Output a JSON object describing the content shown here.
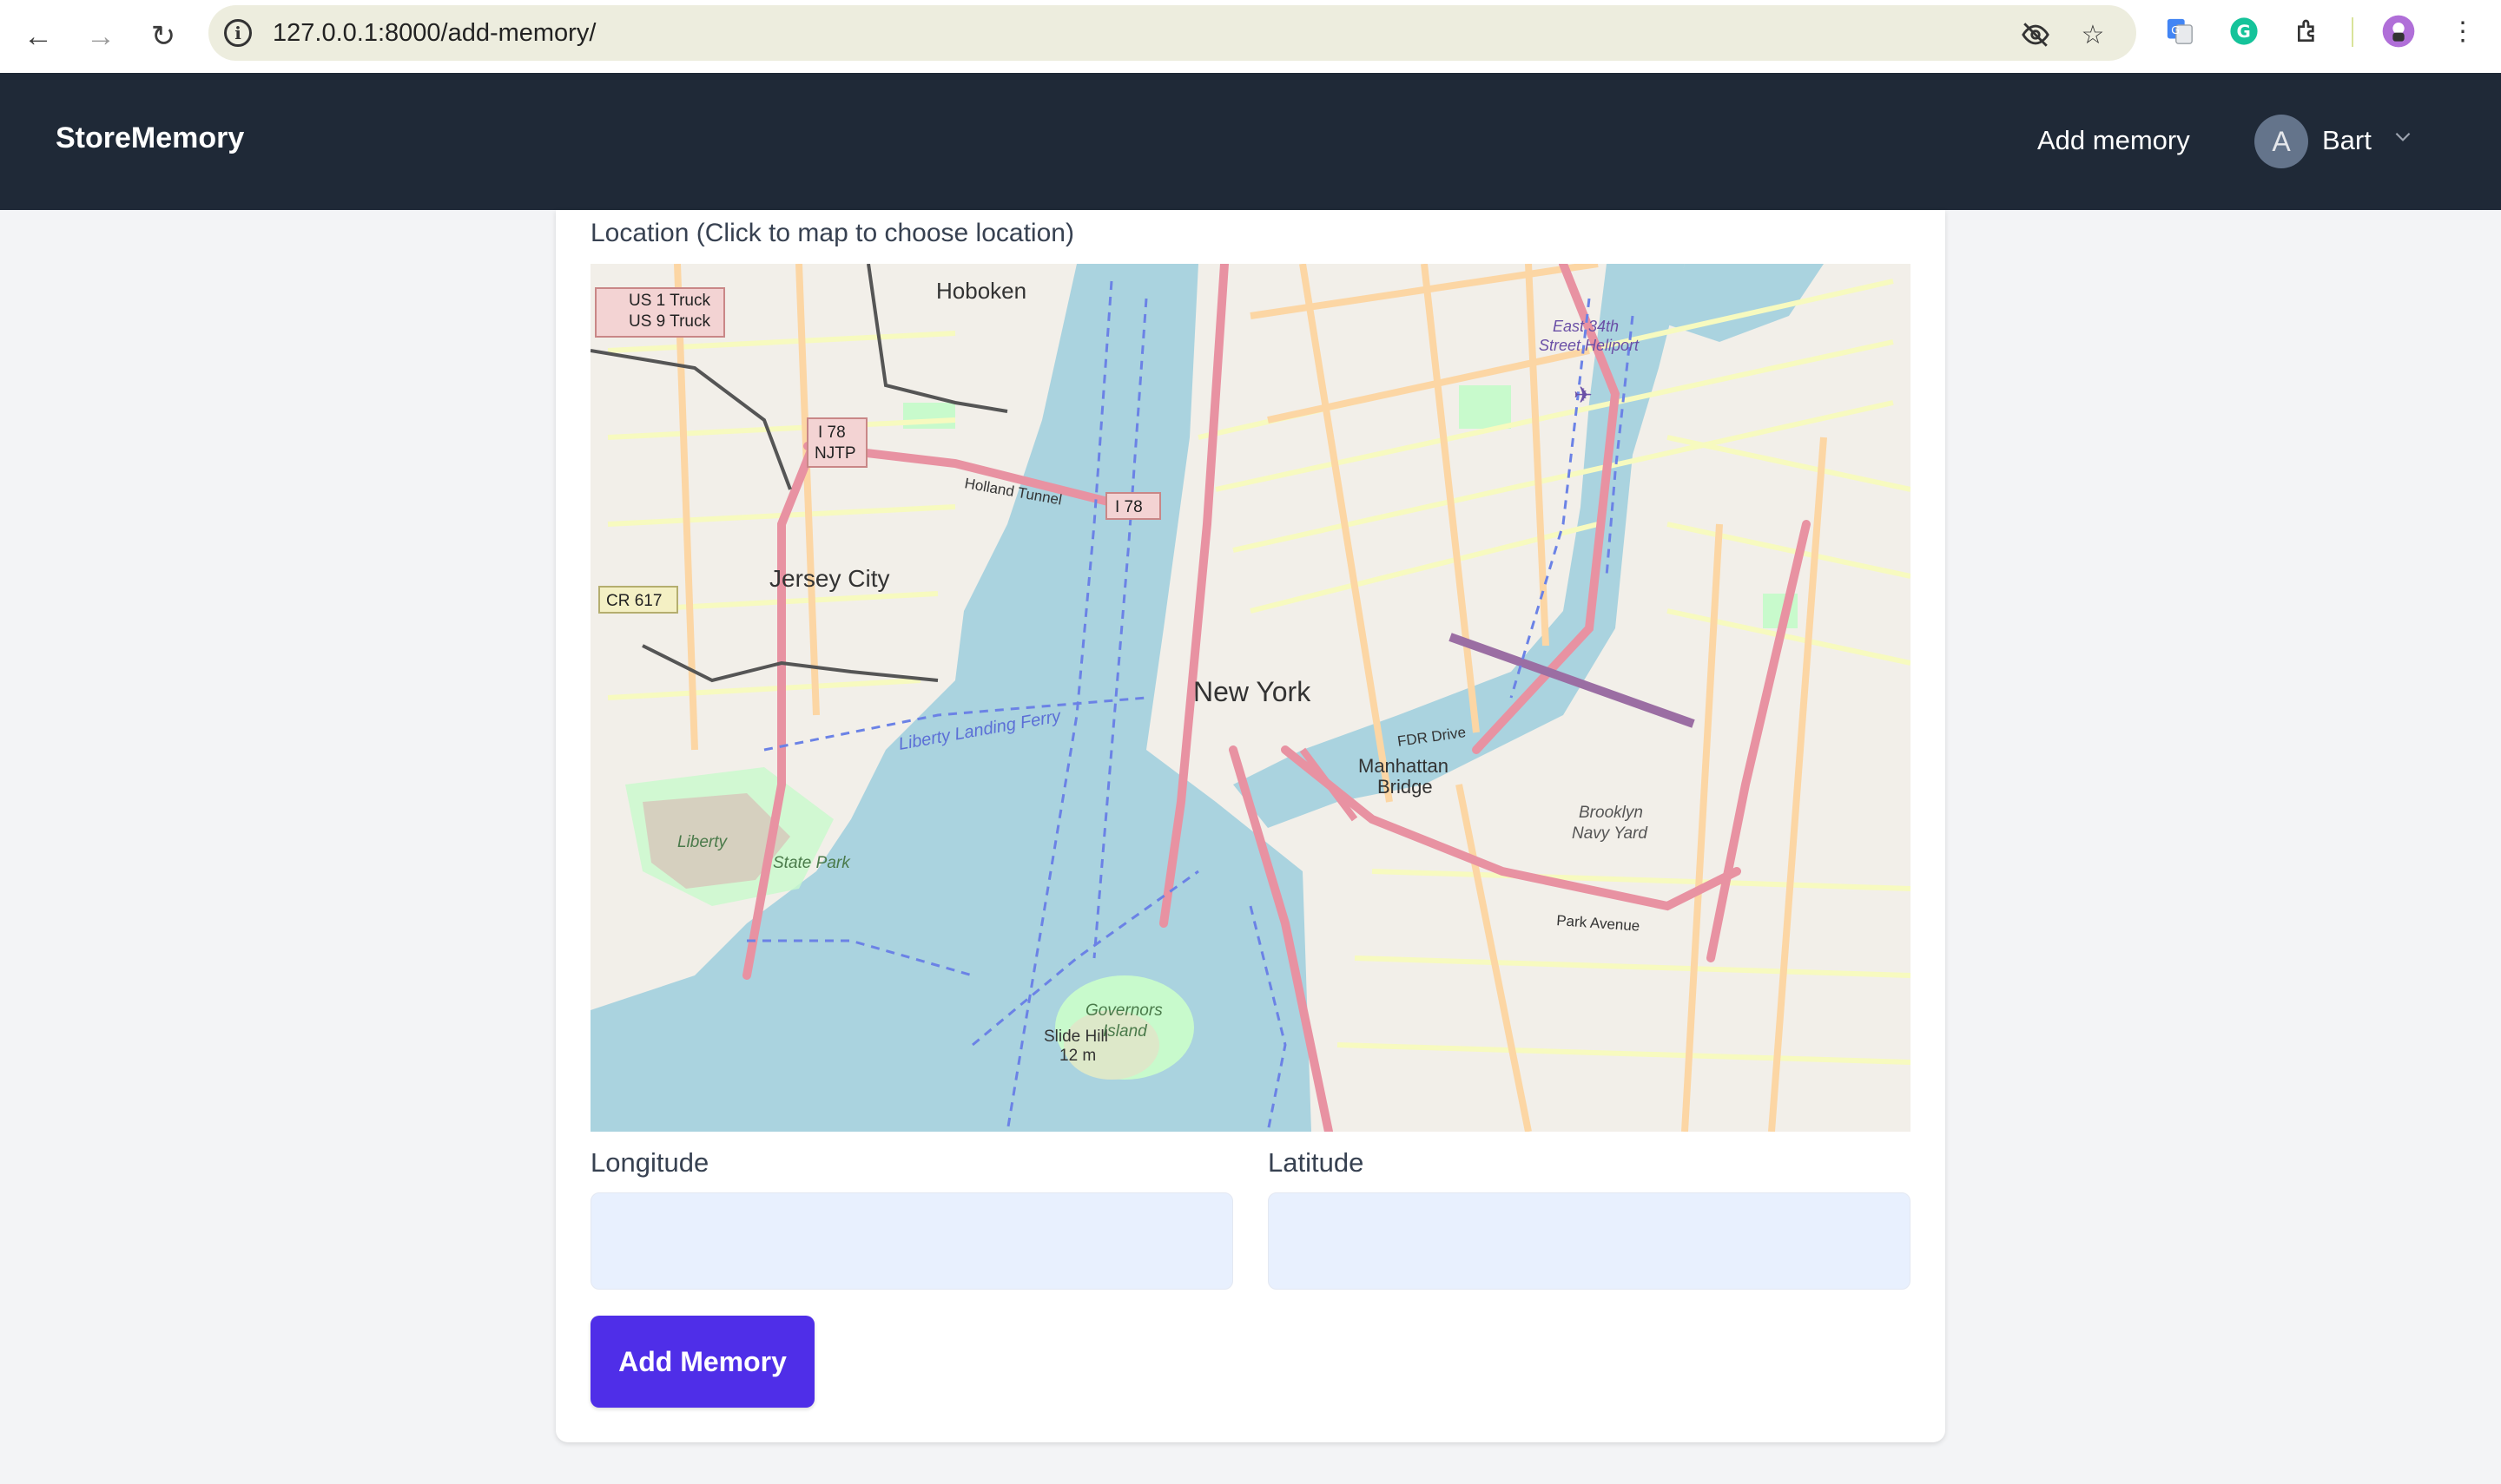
{
  "browser": {
    "url": "127.0.0.1:8000/add-memory/",
    "icons": [
      "back-icon",
      "forward-icon",
      "reload-icon",
      "site-info-icon",
      "eye-off-icon",
      "star-icon",
      "translate-icon",
      "grammarly-icon",
      "extensions-icon",
      "profile-icon",
      "menu-dots-icon"
    ]
  },
  "navbar": {
    "brand": "StoreMemory",
    "add_memory_link": "Add memory",
    "user": {
      "initial": "A",
      "name": "Bart"
    }
  },
  "form": {
    "map_label": "Location (Click to map to choose location)",
    "longitude_label": "Longitude",
    "longitude_value": "",
    "latitude_label": "Latitude",
    "latitude_value": "",
    "submit_label": "Add Memory"
  },
  "map": {
    "labels": {
      "hoboken": "Hoboken",
      "jersey_city": "Jersey City",
      "new_york": "New York",
      "manhattan_bridge_1": "Manhattan",
      "manhattan_bridge_2": "Bridge",
      "liberty_park_1": "Liberty",
      "liberty_park_2": "State Park",
      "governors_1": "Governors",
      "governors_2": "Island",
      "slide_hill_1": "Slide Hill",
      "slide_hill_2": "12 m",
      "navy_yard_1": "Brooklyn",
      "navy_yard_2": "Navy Yard",
      "heliport_1": "East 34th",
      "heliport_2": "Street Heliport",
      "us1_1": "US 1 Truck",
      "us1_2": "US 9 Truck",
      "i78_njtp_1": "I 78",
      "i78_njtp_2": "NJTP",
      "i78": "I 78",
      "cr617": "CR 617",
      "holland_tunnel": "Holland Tunnel",
      "fdr_drive": "FDR Drive",
      "park_avenue": "Park Avenue",
      "liberty_landing": "Liberty Landing Ferry"
    },
    "colors": {
      "water": "#aad3df",
      "land": "#f2efe9",
      "major_road": "#e892a2",
      "primary_road": "#fcd6a4",
      "secondary_road": "#f7fabf",
      "park": "#c8facc",
      "ferry": "#6b82e6"
    }
  }
}
